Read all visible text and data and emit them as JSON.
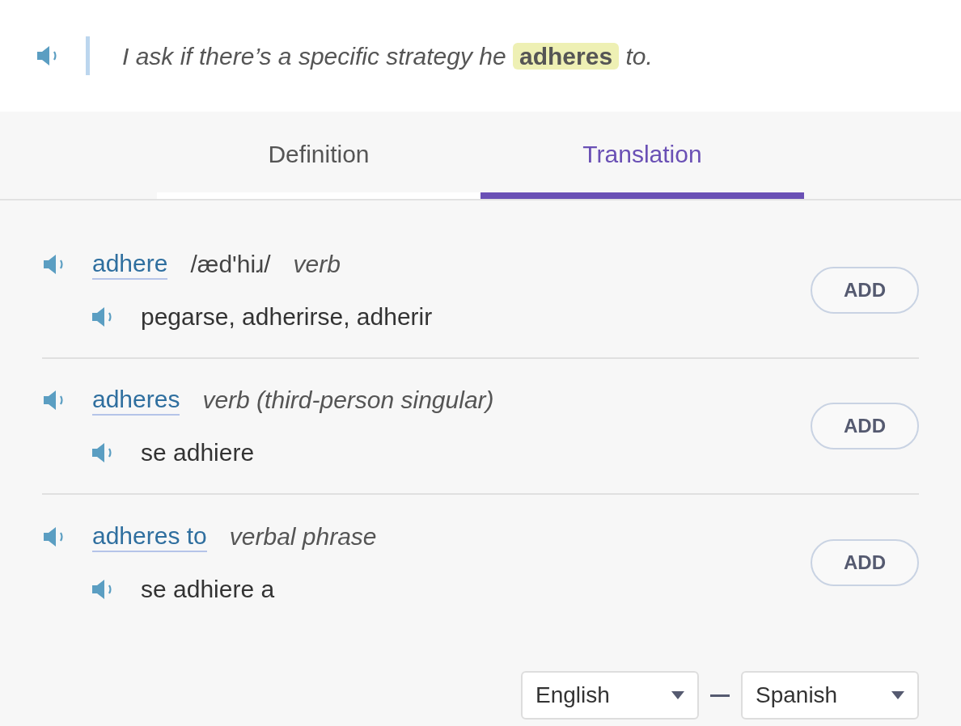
{
  "sentence": {
    "before": "I ask if there’s a specific strategy he",
    "highlight": "adheres",
    "after": "to."
  },
  "tabs": [
    {
      "label": "Definition",
      "selected": false
    },
    {
      "label": "Translation",
      "selected": true
    }
  ],
  "entries": [
    {
      "word": "adhere",
      "pronunciation": "/æd'hiɹ/",
      "pos": "verb",
      "translation": "pegarse, adherirse, adherir",
      "button": "ADD"
    },
    {
      "word": "adheres",
      "pos": "verb (third-person singular)",
      "translation": "se adhiere",
      "button": "ADD"
    },
    {
      "word": "adheres to",
      "pos": "verbal phrase",
      "translation": "se adhiere a",
      "button": "ADD"
    }
  ],
  "languages": {
    "from": "English",
    "to": "Spanish"
  }
}
